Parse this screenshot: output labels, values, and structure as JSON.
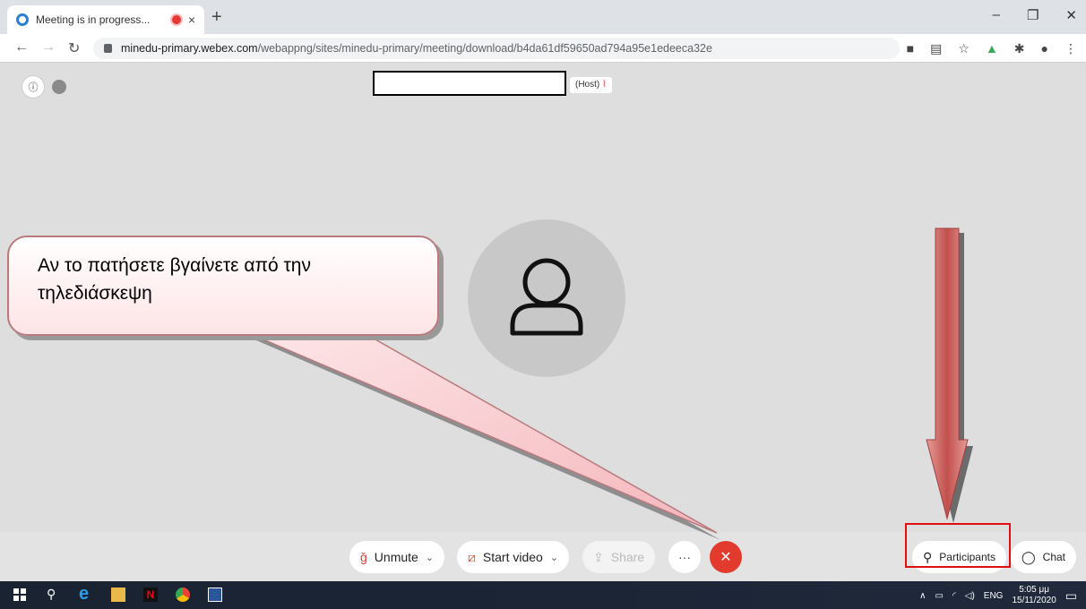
{
  "browser": {
    "tab_title": "Meeting is in progress...",
    "tab_close": "×",
    "new_tab": "+",
    "window_minimize": "–",
    "window_restore": "❐",
    "window_close": "✕",
    "url_domain": "minedu-primary.webex.com",
    "url_path": "/webappng/sites/minedu-primary/meeting/download/b4da61df59650ad794a95e1edeeca32e"
  },
  "meeting": {
    "info_icon": "ⓘ",
    "host_label": "(Host)",
    "host_mic_icon": "🎙̸"
  },
  "controls": {
    "unmute_label": "Unmute",
    "start_video_label": "Start video",
    "share_label": "Share",
    "more_label": "···",
    "leave_label": "✕",
    "participants_label": "Participants",
    "chat_label": "Chat",
    "chevron": "⌄"
  },
  "annotation": {
    "callout_text": "Αν το πατήσετε   βγαίνετε από την τηλεδιάσκεψη",
    "arrow_color": "#c0504d",
    "highlight_color": "#e01010"
  },
  "taskbar": {
    "language": "ENG",
    "time": "5:05 μμ",
    "date": "15/11/2020"
  }
}
